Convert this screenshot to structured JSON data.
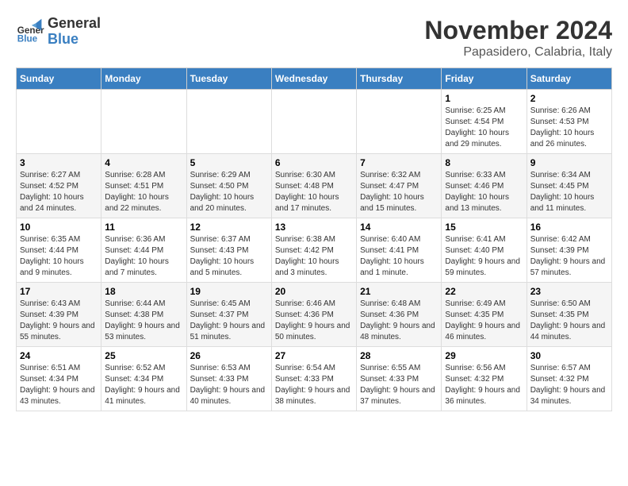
{
  "logo": {
    "text_general": "General",
    "text_blue": "Blue"
  },
  "title": "November 2024",
  "location": "Papasidero, Calabria, Italy",
  "days_of_week": [
    "Sunday",
    "Monday",
    "Tuesday",
    "Wednesday",
    "Thursday",
    "Friday",
    "Saturday"
  ],
  "weeks": [
    [
      {
        "day": "",
        "info": ""
      },
      {
        "day": "",
        "info": ""
      },
      {
        "day": "",
        "info": ""
      },
      {
        "day": "",
        "info": ""
      },
      {
        "day": "",
        "info": ""
      },
      {
        "day": "1",
        "info": "Sunrise: 6:25 AM\nSunset: 4:54 PM\nDaylight: 10 hours and 29 minutes."
      },
      {
        "day": "2",
        "info": "Sunrise: 6:26 AM\nSunset: 4:53 PM\nDaylight: 10 hours and 26 minutes."
      }
    ],
    [
      {
        "day": "3",
        "info": "Sunrise: 6:27 AM\nSunset: 4:52 PM\nDaylight: 10 hours and 24 minutes."
      },
      {
        "day": "4",
        "info": "Sunrise: 6:28 AM\nSunset: 4:51 PM\nDaylight: 10 hours and 22 minutes."
      },
      {
        "day": "5",
        "info": "Sunrise: 6:29 AM\nSunset: 4:50 PM\nDaylight: 10 hours and 20 minutes."
      },
      {
        "day": "6",
        "info": "Sunrise: 6:30 AM\nSunset: 4:48 PM\nDaylight: 10 hours and 17 minutes."
      },
      {
        "day": "7",
        "info": "Sunrise: 6:32 AM\nSunset: 4:47 PM\nDaylight: 10 hours and 15 minutes."
      },
      {
        "day": "8",
        "info": "Sunrise: 6:33 AM\nSunset: 4:46 PM\nDaylight: 10 hours and 13 minutes."
      },
      {
        "day": "9",
        "info": "Sunrise: 6:34 AM\nSunset: 4:45 PM\nDaylight: 10 hours and 11 minutes."
      }
    ],
    [
      {
        "day": "10",
        "info": "Sunrise: 6:35 AM\nSunset: 4:44 PM\nDaylight: 10 hours and 9 minutes."
      },
      {
        "day": "11",
        "info": "Sunrise: 6:36 AM\nSunset: 4:44 PM\nDaylight: 10 hours and 7 minutes."
      },
      {
        "day": "12",
        "info": "Sunrise: 6:37 AM\nSunset: 4:43 PM\nDaylight: 10 hours and 5 minutes."
      },
      {
        "day": "13",
        "info": "Sunrise: 6:38 AM\nSunset: 4:42 PM\nDaylight: 10 hours and 3 minutes."
      },
      {
        "day": "14",
        "info": "Sunrise: 6:40 AM\nSunset: 4:41 PM\nDaylight: 10 hours and 1 minute."
      },
      {
        "day": "15",
        "info": "Sunrise: 6:41 AM\nSunset: 4:40 PM\nDaylight: 9 hours and 59 minutes."
      },
      {
        "day": "16",
        "info": "Sunrise: 6:42 AM\nSunset: 4:39 PM\nDaylight: 9 hours and 57 minutes."
      }
    ],
    [
      {
        "day": "17",
        "info": "Sunrise: 6:43 AM\nSunset: 4:39 PM\nDaylight: 9 hours and 55 minutes."
      },
      {
        "day": "18",
        "info": "Sunrise: 6:44 AM\nSunset: 4:38 PM\nDaylight: 9 hours and 53 minutes."
      },
      {
        "day": "19",
        "info": "Sunrise: 6:45 AM\nSunset: 4:37 PM\nDaylight: 9 hours and 51 minutes."
      },
      {
        "day": "20",
        "info": "Sunrise: 6:46 AM\nSunset: 4:36 PM\nDaylight: 9 hours and 50 minutes."
      },
      {
        "day": "21",
        "info": "Sunrise: 6:48 AM\nSunset: 4:36 PM\nDaylight: 9 hours and 48 minutes."
      },
      {
        "day": "22",
        "info": "Sunrise: 6:49 AM\nSunset: 4:35 PM\nDaylight: 9 hours and 46 minutes."
      },
      {
        "day": "23",
        "info": "Sunrise: 6:50 AM\nSunset: 4:35 PM\nDaylight: 9 hours and 44 minutes."
      }
    ],
    [
      {
        "day": "24",
        "info": "Sunrise: 6:51 AM\nSunset: 4:34 PM\nDaylight: 9 hours and 43 minutes."
      },
      {
        "day": "25",
        "info": "Sunrise: 6:52 AM\nSunset: 4:34 PM\nDaylight: 9 hours and 41 minutes."
      },
      {
        "day": "26",
        "info": "Sunrise: 6:53 AM\nSunset: 4:33 PM\nDaylight: 9 hours and 40 minutes."
      },
      {
        "day": "27",
        "info": "Sunrise: 6:54 AM\nSunset: 4:33 PM\nDaylight: 9 hours and 38 minutes."
      },
      {
        "day": "28",
        "info": "Sunrise: 6:55 AM\nSunset: 4:33 PM\nDaylight: 9 hours and 37 minutes."
      },
      {
        "day": "29",
        "info": "Sunrise: 6:56 AM\nSunset: 4:32 PM\nDaylight: 9 hours and 36 minutes."
      },
      {
        "day": "30",
        "info": "Sunrise: 6:57 AM\nSunset: 4:32 PM\nDaylight: 9 hours and 34 minutes."
      }
    ]
  ]
}
